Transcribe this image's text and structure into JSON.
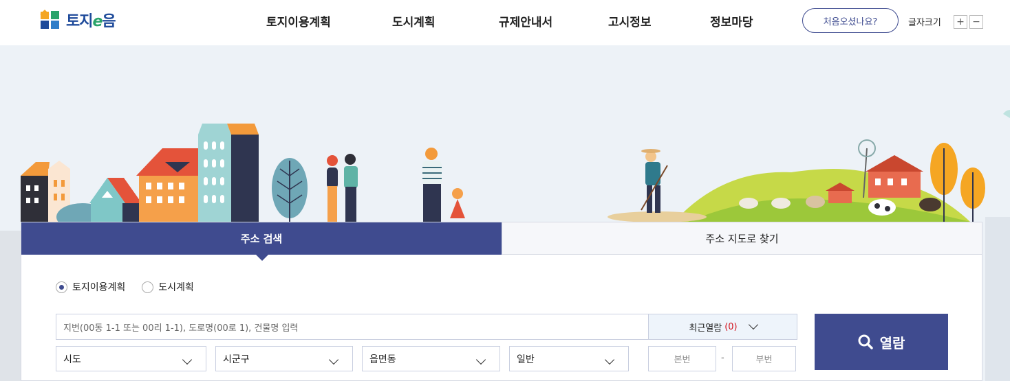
{
  "header": {
    "logo_text_a": "토지",
    "logo_text_e": "e",
    "logo_text_b": "음",
    "nav": [
      "토지이용계획",
      "도시계획",
      "규제안내서",
      "고시정보",
      "정보마당"
    ],
    "first_visit": "처음오셨나요?",
    "font_size_label": "글자크기",
    "font_plus": "+",
    "font_minus": "−"
  },
  "tabs": {
    "address_search": "주소 검색",
    "map_search": "주소 지도로 찾기"
  },
  "radio": {
    "options": [
      "토지이용계획",
      "도시계획"
    ],
    "selected": "토지이용계획"
  },
  "search": {
    "placeholder": "지번(00동 1-1 또는 00리 1-1), 도로명(00로 1), 건물명 입력",
    "recent_label": "최근열람",
    "recent_count": "(0)"
  },
  "selects": {
    "sido": "시도",
    "sigungu": "시군구",
    "eupmyeondong": "읍면동",
    "type": "일반"
  },
  "lot": {
    "main_placeholder": "본번",
    "dash": "-",
    "sub_placeholder": "부번"
  },
  "view_button": "열람",
  "colors": {
    "brand_navy": "#3f4b8f",
    "logo_blue": "#1e4a9a",
    "logo_green": "#2aa36a",
    "recent_count_red": "#d3141e"
  }
}
